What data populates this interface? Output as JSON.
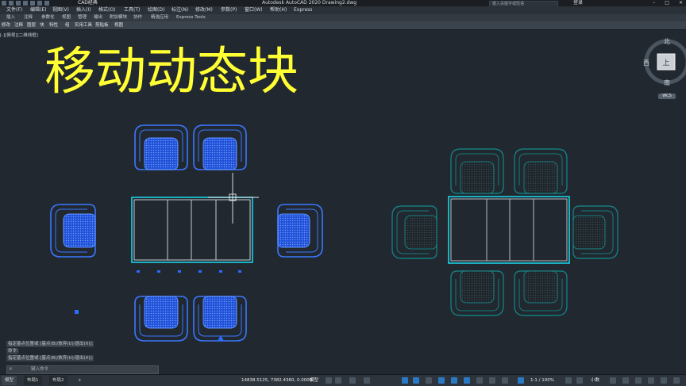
{
  "app": {
    "title": "Autodesk AutoCAD 2020    Drawing2.dwg",
    "workspace": "CAD经典",
    "search_placeholder": "键入关键字或短语",
    "user": "登录"
  },
  "menu": [
    "文件(F)",
    "编辑(E)",
    "视图(V)",
    "插入(I)",
    "格式(O)",
    "工具(T)",
    "绘图(D)",
    "标注(N)",
    "修改(M)",
    "参数(P)",
    "窗口(W)",
    "帮助(H)",
    "Express"
  ],
  "ribbon_tabs": [
    "插入",
    "注释",
    "参数化",
    "视图",
    "管理",
    "输出",
    "附加模块",
    "协作",
    "精选应用",
    "Express Tools"
  ],
  "ribbon_panels": [
    "修改",
    "注释",
    "图层",
    "块",
    "特性",
    "组",
    "实用工具",
    "剪贴板",
    "视图"
  ],
  "view_label": "[-][俯视][二维线框]",
  "overlay_title": "移动动态块",
  "viewcube": {
    "north": "北",
    "south": "南",
    "west": "西",
    "face": "上",
    "wcs": "WCS"
  },
  "command_history": [
    "指定基点位置或 [基点(B)/放弃(U)/退出(X)]:",
    "命令:",
    "指定基点位置或 [基点(B)/放弃(U)/退出(X)]:"
  ],
  "command_input": {
    "close": "✕",
    "placeholder": "键入命令"
  },
  "layout_tabs": [
    "模型",
    "布局1",
    "布局2",
    "+"
  ],
  "status": {
    "coords": "14838.5125, 7382.4360, 0.0000",
    "mode": "模型",
    "scale": "1:1 / 100%",
    "units": "小数"
  },
  "colors": {
    "selected_blue": "#2a6cff",
    "cyan": "#19d3e6",
    "unselected": "#1a7a7a",
    "title_yellow": "#ffff33",
    "canvas": "#212830"
  }
}
